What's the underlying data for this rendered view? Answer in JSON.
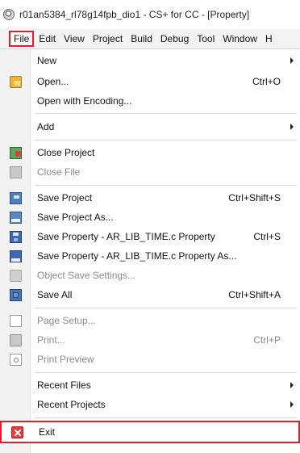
{
  "window": {
    "title": "r01an5384_rl78g14fpb_dio1 - CS+ for CC - [Property]"
  },
  "menubar": {
    "items": [
      "File",
      "Edit",
      "View",
      "Project",
      "Build",
      "Debug",
      "Tool",
      "Window",
      "H"
    ]
  },
  "file_menu": {
    "new": "New",
    "open": "Open...",
    "open_shortcut": "Ctrl+O",
    "open_with_encoding": "Open with Encoding...",
    "add": "Add",
    "close_project": "Close Project",
    "close_file": "Close File",
    "save_project": "Save Project",
    "save_project_shortcut": "Ctrl+Shift+S",
    "save_project_as": "Save Project As...",
    "save_property": "Save Property - AR_LIB_TIME.c Property",
    "save_property_shortcut": "Ctrl+S",
    "save_property_as": "Save Property - AR_LIB_TIME.c Property As...",
    "object_save_settings": "Object Save Settings...",
    "save_all": "Save All",
    "save_all_shortcut": "Ctrl+Shift+A",
    "page_setup": "Page Setup...",
    "print": "Print...",
    "print_shortcut": "Ctrl+P",
    "print_preview": "Print Preview",
    "recent_files": "Recent Files",
    "recent_projects": "Recent Projects",
    "exit": "Exit"
  }
}
